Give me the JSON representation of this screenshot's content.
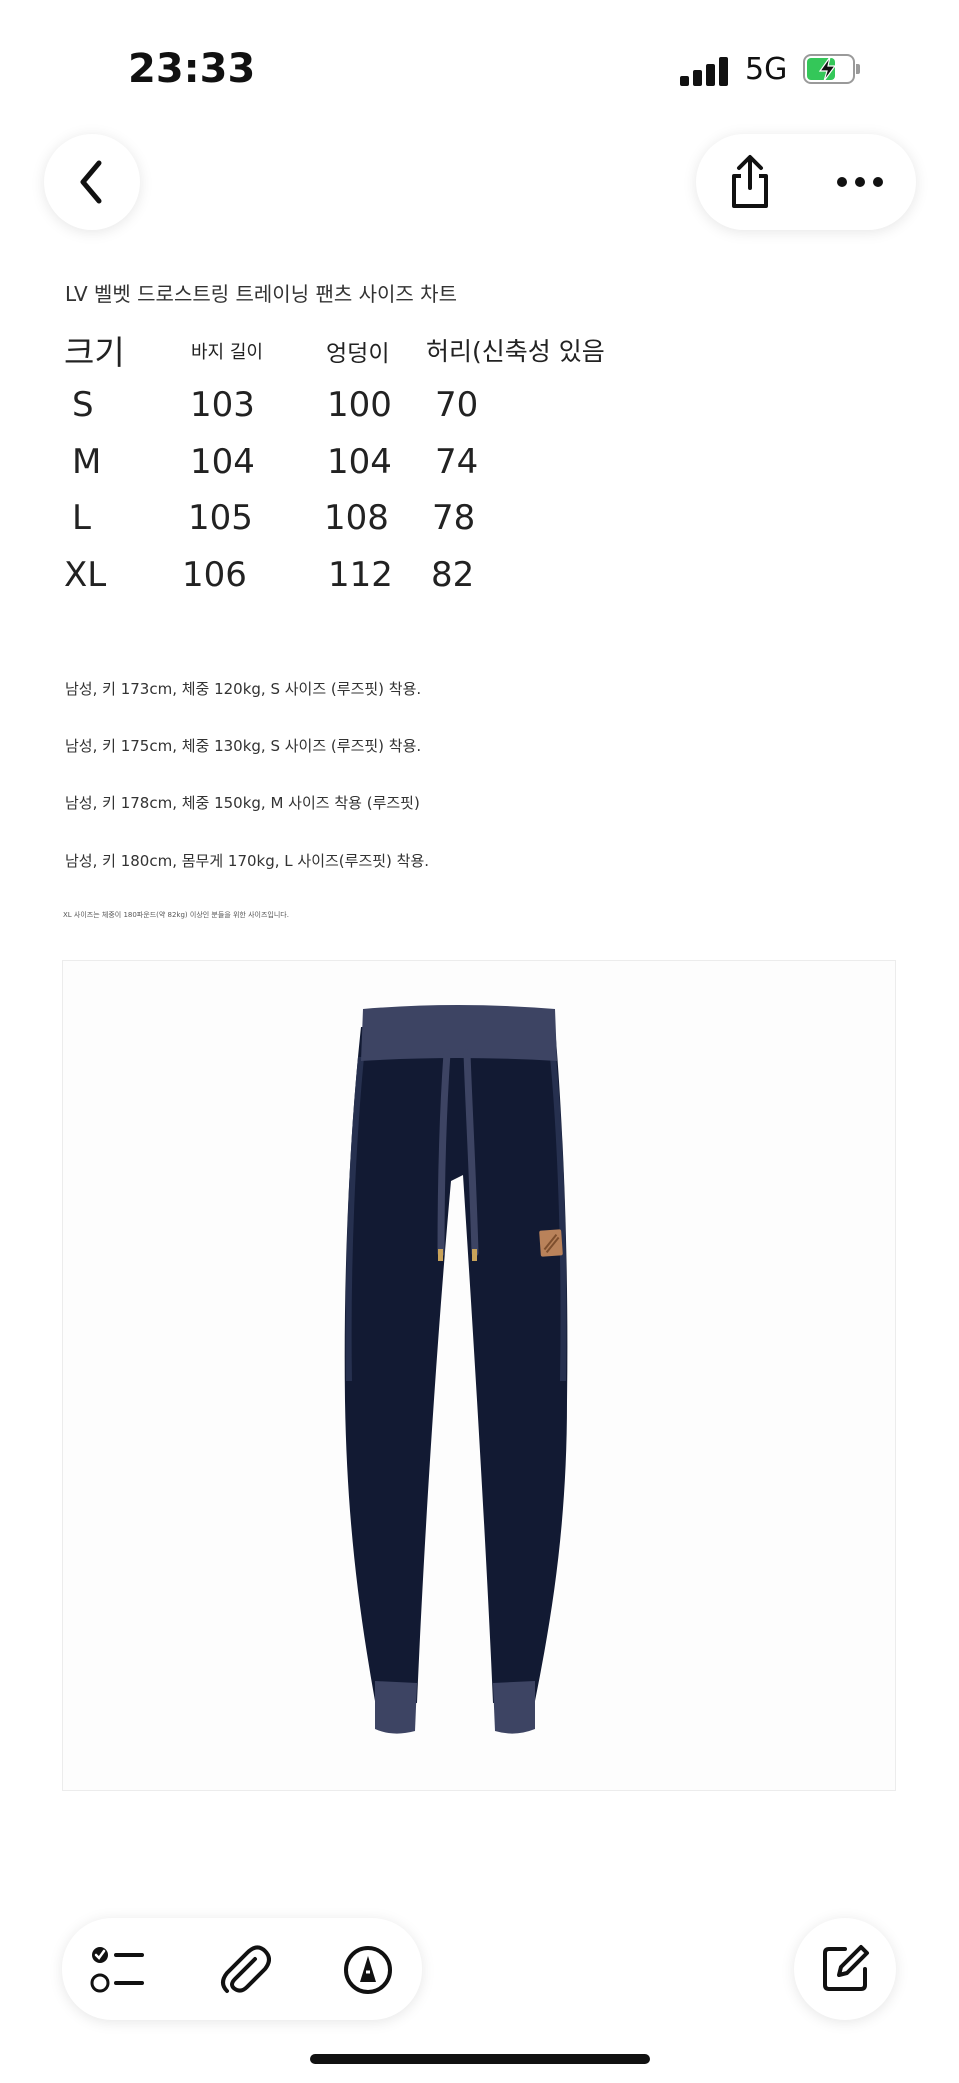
{
  "status_bar": {
    "time": "23:33",
    "network": "5G"
  },
  "nav": {
    "back_icon": "chevron-left-icon",
    "share_icon": "share-icon",
    "more_icon": "ellipsis-icon"
  },
  "document": {
    "title": "LV 벨벳 드로스트링 트레이닝 팬츠 사이즈 차트",
    "table": {
      "headers": [
        "크기",
        "바지 길이",
        "엉덩이",
        "허리(신축성 있음"
      ],
      "rows": [
        [
          "S",
          "103",
          "100",
          "70"
        ],
        [
          "M",
          "104",
          "104",
          "74"
        ],
        [
          "L",
          "105",
          "108",
          "78"
        ],
        [
          "XL",
          "106",
          "112",
          "82"
        ]
      ]
    },
    "notes": [
      "남성, 키 173cm, 체중 120kg, S 사이즈 (루즈핏) 착용.",
      "남성, 키 175cm, 체중 130kg, S 사이즈 (루즈핏) 착용.",
      "남성, 키 178cm, 체중 150kg, M 사이즈 착용 (루즈핏)",
      "남성, 키 180cm, 몸무게 170kg, L 사이즈(루즈핏) 착용."
    ],
    "fine_print": "XL 사이즈는 체중이 180파운드(약 82kg) 이상인 분들을 위한 사이즈입니다.",
    "product_colors": {
      "fabric": "#121a33",
      "rib": "#3d4463",
      "patch": "#b9825a"
    }
  },
  "bottom_bar": {
    "icons": [
      "checklist-icon",
      "paperclip-icon",
      "markup-icon"
    ],
    "compose_icon": "compose-icon"
  }
}
